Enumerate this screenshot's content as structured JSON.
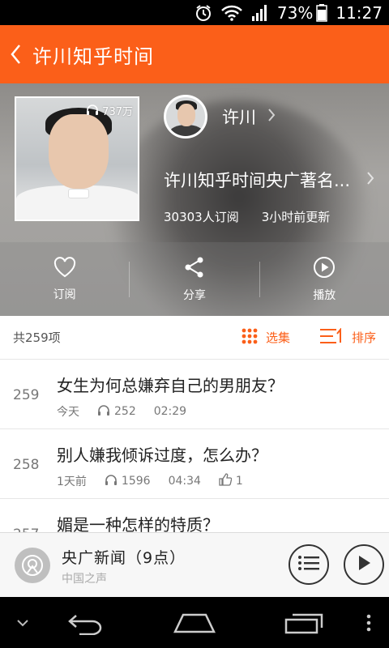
{
  "status_bar": {
    "battery": "73%",
    "time": "11:27",
    "icons": [
      "alarm-icon",
      "wifi-icon",
      "signal-icon",
      "battery-icon"
    ]
  },
  "header": {
    "title": "许川知乎时间",
    "back_icon": "chevron-left-icon"
  },
  "album": {
    "play_count": "737万",
    "author": "许川",
    "description": "许川知乎时间央广著名...",
    "subscribers": "30303人订阅",
    "updated": "3小时前更新"
  },
  "actions": [
    {
      "label": "订阅",
      "icon": "heart-icon"
    },
    {
      "label": "分享",
      "icon": "share-icon"
    },
    {
      "label": "播放",
      "icon": "play-circle-icon"
    }
  ],
  "list_header": {
    "count": "共259项",
    "select_label": "选集",
    "sort_label": "排序"
  },
  "episodes": [
    {
      "num": "259",
      "title": "女生为何总嫌弃自己的男朋友？",
      "date": "今天",
      "plays": "252",
      "duration": "02:29",
      "likes": ""
    },
    {
      "num": "258",
      "title": "别人嫌我倾诉过度，怎么办？",
      "date": "1天前",
      "plays": "1596",
      "duration": "04:34",
      "likes": "1"
    },
    {
      "num": "257",
      "title": "媚是一种怎样的特质？",
      "date": "",
      "plays": "",
      "duration": "",
      "likes": ""
    }
  ],
  "player": {
    "name": "央广新闻（9点）",
    "source": "中国之声"
  },
  "colors": {
    "accent": "#fb5f19"
  }
}
